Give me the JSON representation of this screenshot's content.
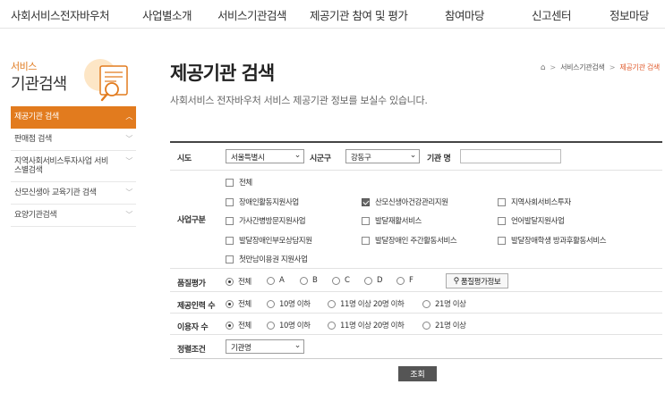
{
  "nav": {
    "items": [
      "사회서비스전자바우처",
      "사업별소개",
      "서비스기관검색",
      "제공기관 참여 및 평가",
      "참여마당",
      "신고센터",
      "정보마당"
    ]
  },
  "sidebar": {
    "brand_sub": "서비스",
    "brand_main": "기관검색",
    "items": [
      {
        "label": "제공기관 검색",
        "active": true
      },
      {
        "label": "판매점 검색"
      },
      {
        "label": "지역사회서비스투자사업 서비스별검색"
      },
      {
        "label": "산모신생아 교육기관 검색"
      },
      {
        "label": "요양기관검색"
      }
    ]
  },
  "page": {
    "title": "제공기관 검색",
    "description": "사회서비스 전자바우처 서비스 제공기관 정보를 보실수 있습니다."
  },
  "breadcrumb": {
    "home_icon": "home-icon",
    "section": "서비스기관검색",
    "current": "제공기관 검색"
  },
  "form": {
    "sido_label": "시도",
    "sido_value": "서울특별시",
    "sigungu_label": "시군구",
    "sigungu_value": "강동구",
    "org_name_label": "기관 명",
    "org_name_value": "",
    "business_label": "사업구분",
    "business_all": "전체",
    "business_items": [
      {
        "label": "장애인활동지원사업",
        "checked": false
      },
      {
        "label": "산모신생아건강관리지원",
        "checked": true
      },
      {
        "label": "지역사회서비스투자",
        "checked": false
      },
      {
        "label": "가사간병방문지원사업",
        "checked": false
      },
      {
        "label": "발달재활서비스",
        "checked": false
      },
      {
        "label": "언어발달지원사업",
        "checked": false
      },
      {
        "label": "발달장애인부모상담지원",
        "checked": false
      },
      {
        "label": "발달장애인 주간활동서비스",
        "checked": false
      },
      {
        "label": "발달장애학생 방과후활동서비스",
        "checked": false
      },
      {
        "label": "첫만남이용권 지원사업",
        "checked": false
      }
    ],
    "grade_label": "품질평가",
    "grade_options": [
      "전체",
      "A",
      "B",
      "C",
      "D",
      "F"
    ],
    "grade_selected": "전체",
    "grade_button": "품질평가정보",
    "staff_label": "제공인력 수",
    "staff_options": [
      "전체",
      "10명 이하",
      "11명 이상 20명 이하",
      "21명 이상"
    ],
    "staff_selected": "전체",
    "users_label": "이용자 수",
    "users_options": [
      "전체",
      "10명 이하",
      "11명 이상 20명 이하",
      "21명 이상"
    ],
    "users_selected": "전체",
    "sort_label": "정렬조건",
    "sort_value": "기관명",
    "submit_label": "조회"
  },
  "colors": {
    "accent": "#e27b1e",
    "breadcrumb_current": "#e05a2b",
    "button_dark": "#555555"
  }
}
